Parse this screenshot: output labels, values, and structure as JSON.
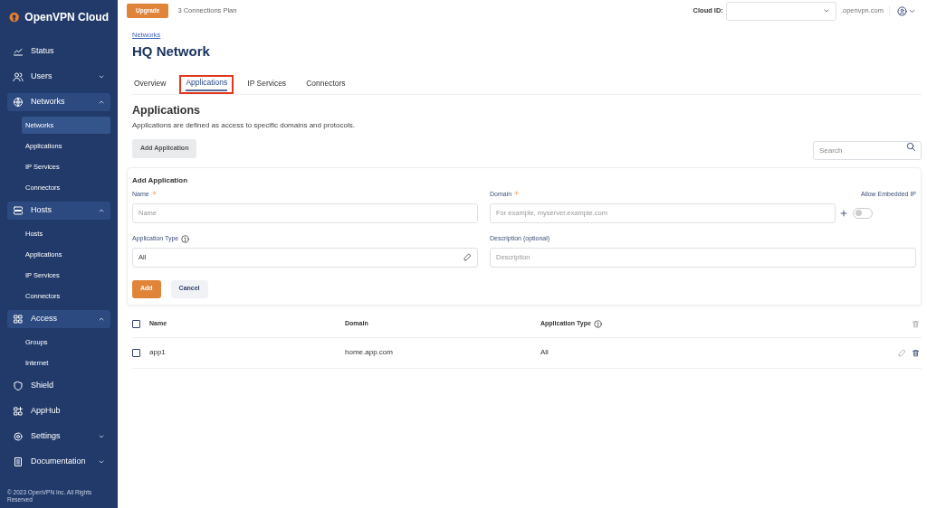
{
  "sidebar": {
    "brand": "OpenVPN Cloud",
    "items": [
      {
        "label": "Status",
        "expandable": false,
        "expanded": false
      },
      {
        "label": "Users",
        "expandable": true,
        "expanded": false
      },
      {
        "label": "Networks",
        "expandable": true,
        "expanded": true,
        "children": [
          {
            "label": "Networks",
            "selected": true
          },
          {
            "label": "Applications",
            "selected": false
          },
          {
            "label": "IP Services",
            "selected": false
          },
          {
            "label": "Connectors",
            "selected": false
          }
        ]
      },
      {
        "label": "Hosts",
        "expandable": true,
        "expanded": true,
        "children": [
          {
            "label": "Hosts",
            "selected": false
          },
          {
            "label": "Applications",
            "selected": false
          },
          {
            "label": "IP Services",
            "selected": false
          },
          {
            "label": "Connectors",
            "selected": false
          }
        ]
      },
      {
        "label": "Access",
        "expandable": true,
        "expanded": true,
        "children": [
          {
            "label": "Groups",
            "selected": false
          },
          {
            "label": "Internet",
            "selected": false
          }
        ]
      },
      {
        "label": "Shield",
        "expandable": false,
        "expanded": false
      },
      {
        "label": "AppHub",
        "expandable": false,
        "expanded": false
      },
      {
        "label": "Settings",
        "expandable": true,
        "expanded": false
      },
      {
        "label": "Documentation",
        "expandable": true,
        "expanded": false
      }
    ],
    "footer": "© 2023 OpenVPN Inc. All Rights Reserved"
  },
  "topbar": {
    "upgrade": "Upgrade",
    "plan": "3 Connections Plan",
    "cloud_id_label": "Cloud ID:",
    "domain_suffix": ".openvpn.com"
  },
  "breadcrumb": "Networks",
  "title": "HQ Network",
  "tabs": [
    {
      "label": "Overview",
      "selected": false,
      "highlighted": false
    },
    {
      "label": "Applications",
      "selected": true,
      "highlighted": true
    },
    {
      "label": "IP Services",
      "selected": false,
      "highlighted": false
    },
    {
      "label": "Connectors",
      "selected": false,
      "highlighted": false
    }
  ],
  "section": {
    "title": "Applications",
    "description": "Applications are defined as access to specific domains and protocols.",
    "add_button": "Add Application",
    "search": {
      "placeholder": "Search"
    }
  },
  "form": {
    "title": "Add Application",
    "name": {
      "label": "Name",
      "required": true,
      "placeholder": "Name"
    },
    "domain": {
      "label": "Domain",
      "required": true,
      "placeholder": "For example, myserver.example.com"
    },
    "embedded_ip": {
      "label": "Allow Embedded IP",
      "on": false
    },
    "app_type": {
      "label": "Application Type",
      "help": true,
      "value": "All"
    },
    "description": {
      "label": "Description (optional)",
      "placeholder": "Description"
    },
    "buttons": [
      "Add",
      "Cancel"
    ]
  },
  "table": {
    "all_checked": false,
    "columns": [
      {
        "label": "Name",
        "help": false
      },
      {
        "label": "Domain",
        "help": false
      },
      {
        "label": "Application Type",
        "help": true
      }
    ],
    "rows": [
      {
        "checked": false,
        "cells": [
          "app1",
          "home.app.com",
          "All"
        ]
      }
    ]
  }
}
